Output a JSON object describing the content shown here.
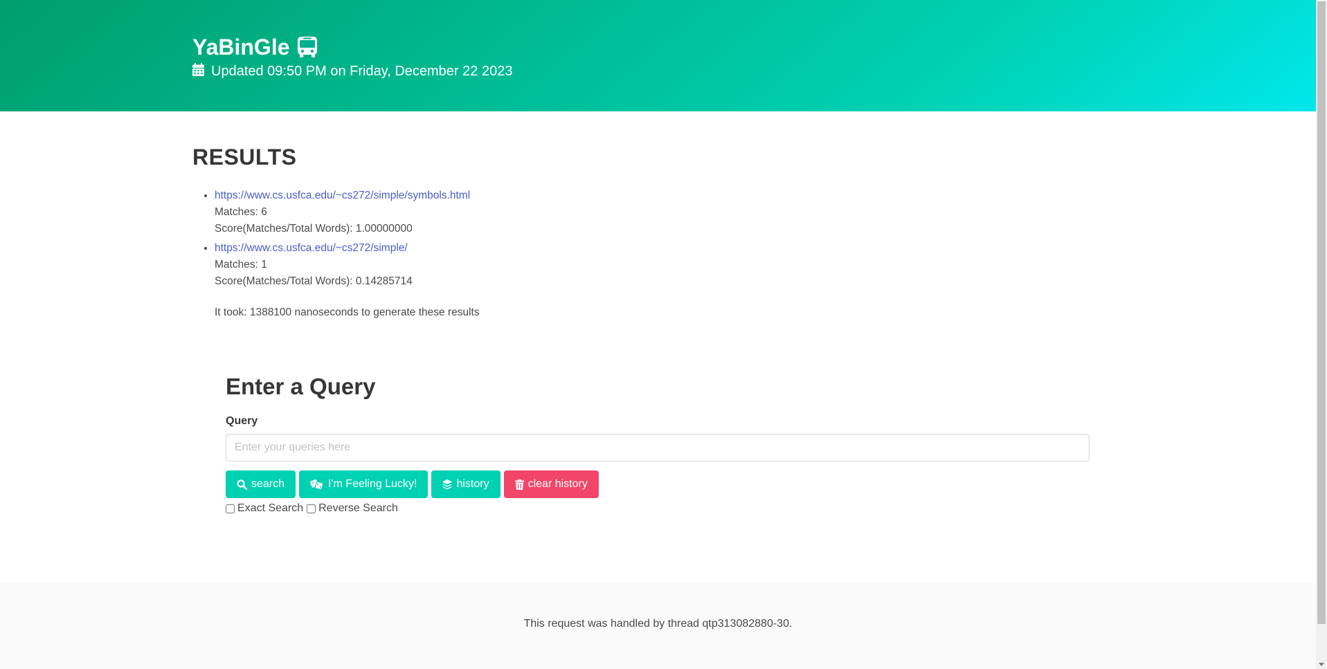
{
  "header": {
    "title": "YaBinGle",
    "title_icon": "bus-icon",
    "updated_icon": "calendar-icon",
    "updated_text": "Updated 09:50 PM on Friday, December 22 2023",
    "gradient_colors": [
      "#009e6c",
      "#00d1b2",
      "#00e7eb"
    ]
  },
  "results": {
    "title": "RESULTS",
    "items": [
      {
        "url": "https://www.cs.usfca.edu/~cs272/simple/symbols.html",
        "matches": "Matches: 6",
        "score": "Score(Matches/Total Words): 1.00000000"
      },
      {
        "url": "https://www.cs.usfca.edu/~cs272/simple/",
        "matches": "Matches: 1",
        "score": "Score(Matches/Total Words): 0.14285714"
      }
    ],
    "timing": "It took: 1388100 nanoseconds to generate these results"
  },
  "query": {
    "title": "Enter a Query",
    "label": "Query",
    "value": "",
    "placeholder": "Enter your queries here",
    "buttons": {
      "search": "search",
      "lucky": "I'm Feeling Lucky!",
      "history": "history",
      "clear_history": "clear history"
    },
    "checkboxes": {
      "exact": "Exact Search",
      "reverse": "Reverse Search"
    }
  },
  "footer": {
    "text": "This request was handled by thread qtp313082880-30."
  },
  "colors": {
    "primary": "#00d1b2",
    "danger": "#f14668",
    "link": "#485fc7"
  }
}
